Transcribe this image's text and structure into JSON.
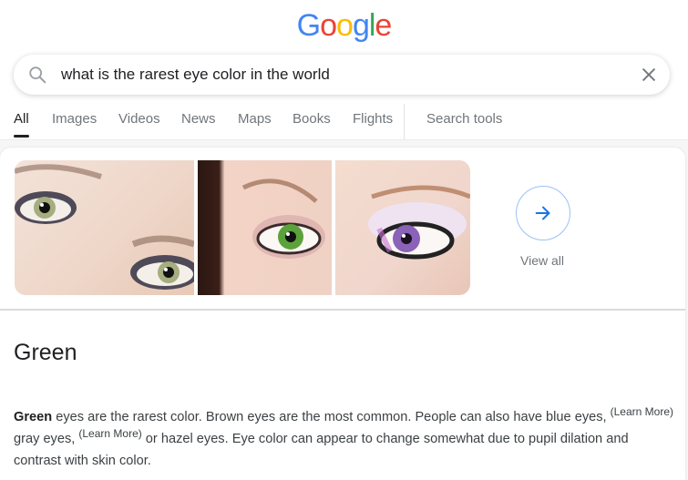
{
  "logo": {
    "letters": [
      {
        "char": "G",
        "color": "#4285f4"
      },
      {
        "char": "o",
        "color": "#ea4335"
      },
      {
        "char": "o",
        "color": "#fbbc05"
      },
      {
        "char": "g",
        "color": "#4285f4"
      },
      {
        "char": "l",
        "color": "#34a853"
      },
      {
        "char": "e",
        "color": "#ea4335"
      }
    ]
  },
  "search": {
    "query": "what is the rarest eye color in the world",
    "search_icon": "search-icon",
    "clear_icon": "close-icon"
  },
  "tabs": [
    {
      "label": "All",
      "active": true
    },
    {
      "label": "Images"
    },
    {
      "label": "Videos"
    },
    {
      "label": "News"
    },
    {
      "label": "Maps"
    },
    {
      "label": "Books"
    },
    {
      "label": "Flights"
    }
  ],
  "search_tools_label": "Search tools",
  "images": [
    {
      "description": "close-up of green-hazel eyes with smoky makeup"
    },
    {
      "description": "green eye with pink eyeshadow"
    },
    {
      "description": "violet eye with long lashes"
    }
  ],
  "view_all": {
    "label": "View all",
    "icon": "arrow-right-icon"
  },
  "answer": {
    "title": "Green"
  },
  "description": {
    "bold": "Green",
    "part1": " eyes are the rarest color. Brown eyes are the most common. People can also have blue eyes, ",
    "learn_more_1": "(Learn More)",
    "part2": " gray eyes, ",
    "learn_more_2": "(Learn More)",
    "part3": " or hazel eyes. Eye color can appear to change somewhat due to pupil dilation and contrast with skin color."
  },
  "colors": {
    "accent": "#1a73e8",
    "text": "#202124",
    "muted": "#70757a"
  }
}
